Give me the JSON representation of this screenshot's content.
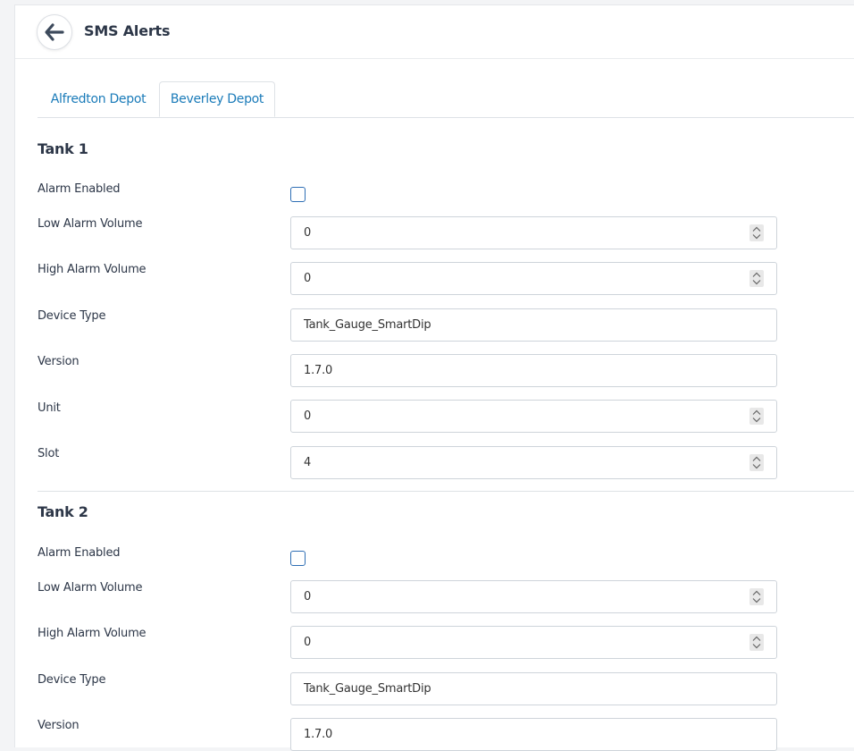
{
  "header": {
    "title": "SMS Alerts",
    "back_icon": "arrow-left-icon"
  },
  "tabs": [
    {
      "label": "Alfredton Depot",
      "active": false
    },
    {
      "label": "Beverley Depot",
      "active": true
    }
  ],
  "tanks": [
    {
      "title": "Tank 1",
      "fields": {
        "alarm_enabled_label": "Alarm Enabled",
        "alarm_enabled": false,
        "low_label": "Low Alarm Volume",
        "low_value": "0",
        "high_label": "High Alarm Volume",
        "high_value": "0",
        "device_label": "Device Type",
        "device_value": "Tank_Gauge_SmartDip",
        "version_label": "Version",
        "version_value": "1.7.0",
        "unit_label": "Unit",
        "unit_value": "0",
        "slot_label": "Slot",
        "slot_value": "4"
      }
    },
    {
      "title": "Tank 2",
      "fields": {
        "alarm_enabled_label": "Alarm Enabled",
        "alarm_enabled": false,
        "low_label": "Low Alarm Volume",
        "low_value": "0",
        "high_label": "High Alarm Volume",
        "high_value": "0",
        "device_label": "Device Type",
        "device_value": "Tank_Gauge_SmartDip",
        "version_label": "Version",
        "version_value": "1.7.0"
      }
    }
  ],
  "colors": {
    "accent": "#1a7bb9",
    "checkbox_border": "#2f6fb5",
    "text": "#2d3748"
  }
}
